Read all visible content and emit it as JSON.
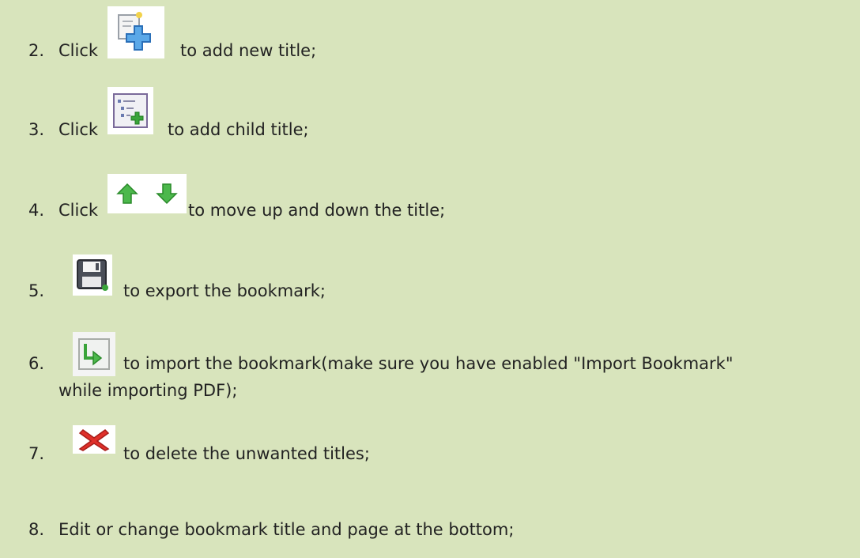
{
  "steps": [
    {
      "num": "2.",
      "click": "Click",
      "text": "to add new title;",
      "icon": "add-title-icon"
    },
    {
      "num": "3.",
      "click": "Click",
      "text": "to add child title;",
      "icon": "add-child-title-icon"
    },
    {
      "num": "4.",
      "click": "Click",
      "text": "to move up and down the title;",
      "icons": [
        "arrow-up-icon",
        "arrow-down-icon"
      ]
    },
    {
      "num": "5.",
      "text": "to export the bookmark;",
      "icon": "save-icon"
    },
    {
      "num": "6.",
      "text": "to import the bookmark(make sure you have enabled \"Import Bookmark\"",
      "text2": "while importing PDF);",
      "icon": "import-icon"
    },
    {
      "num": "7.",
      "text": "to delete the unwanted titles;",
      "icon": "delete-icon"
    },
    {
      "num": "8.",
      "text": "Edit or change bookmark title and page at the bottom;"
    }
  ],
  "colors": {
    "background": "#d8e4bc",
    "arrow_green": "#3aa43a",
    "delete_red": "#e0302a",
    "plus_blue": "#3a8fd8"
  }
}
